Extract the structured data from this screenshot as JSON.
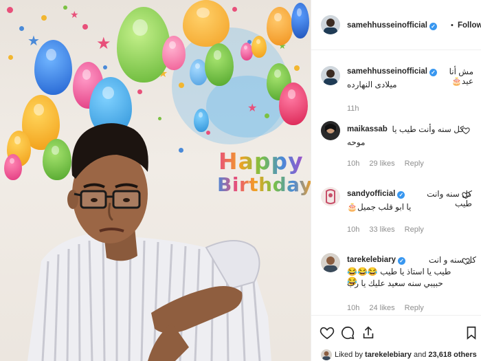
{
  "post": {
    "author": "samehhusseinofficial",
    "follow_label": "Following",
    "separator": "•",
    "caption_line1": "مش أنا عيد🎂",
    "caption_line2": "ميلادى النهارده",
    "caption_time": "11h",
    "image_happy": "Happy",
    "image_birthday": "Birthday"
  },
  "comments": [
    {
      "user": "maikassab",
      "verified": false,
      "line1": "كل سنه وأنت طيب يا",
      "line2": "موحه",
      "time": "10h",
      "likes": "29 likes",
      "reply": "Reply"
    },
    {
      "user": "sandyofficial",
      "verified": true,
      "line1": "كل سنه وانت طيب",
      "line2": "يا ابو قلب جميل🎂",
      "time": "10h",
      "likes": "33 likes",
      "reply": "Reply"
    },
    {
      "user": "tarekelebiary",
      "verified": true,
      "line1": "كل سنه و انت",
      "line2": "طيب يا استاذ يا طيب 😂😂😂😂",
      "line3": "حبيبي سنه سعيد عليك يا رب",
      "time": "10h",
      "likes": "24 likes",
      "reply": "Reply"
    }
  ],
  "likes_summary": {
    "prefix": "Liked by",
    "user": "tarekelebiary",
    "middle": "and",
    "others": "23,618 others"
  },
  "colors": {
    "verified": "#3897f0",
    "muted": "#8e8e8e",
    "text": "#262626"
  },
  "icons": [
    "heart-icon",
    "comment-icon",
    "share-icon",
    "bookmark-icon",
    "verified-badge-icon"
  ]
}
